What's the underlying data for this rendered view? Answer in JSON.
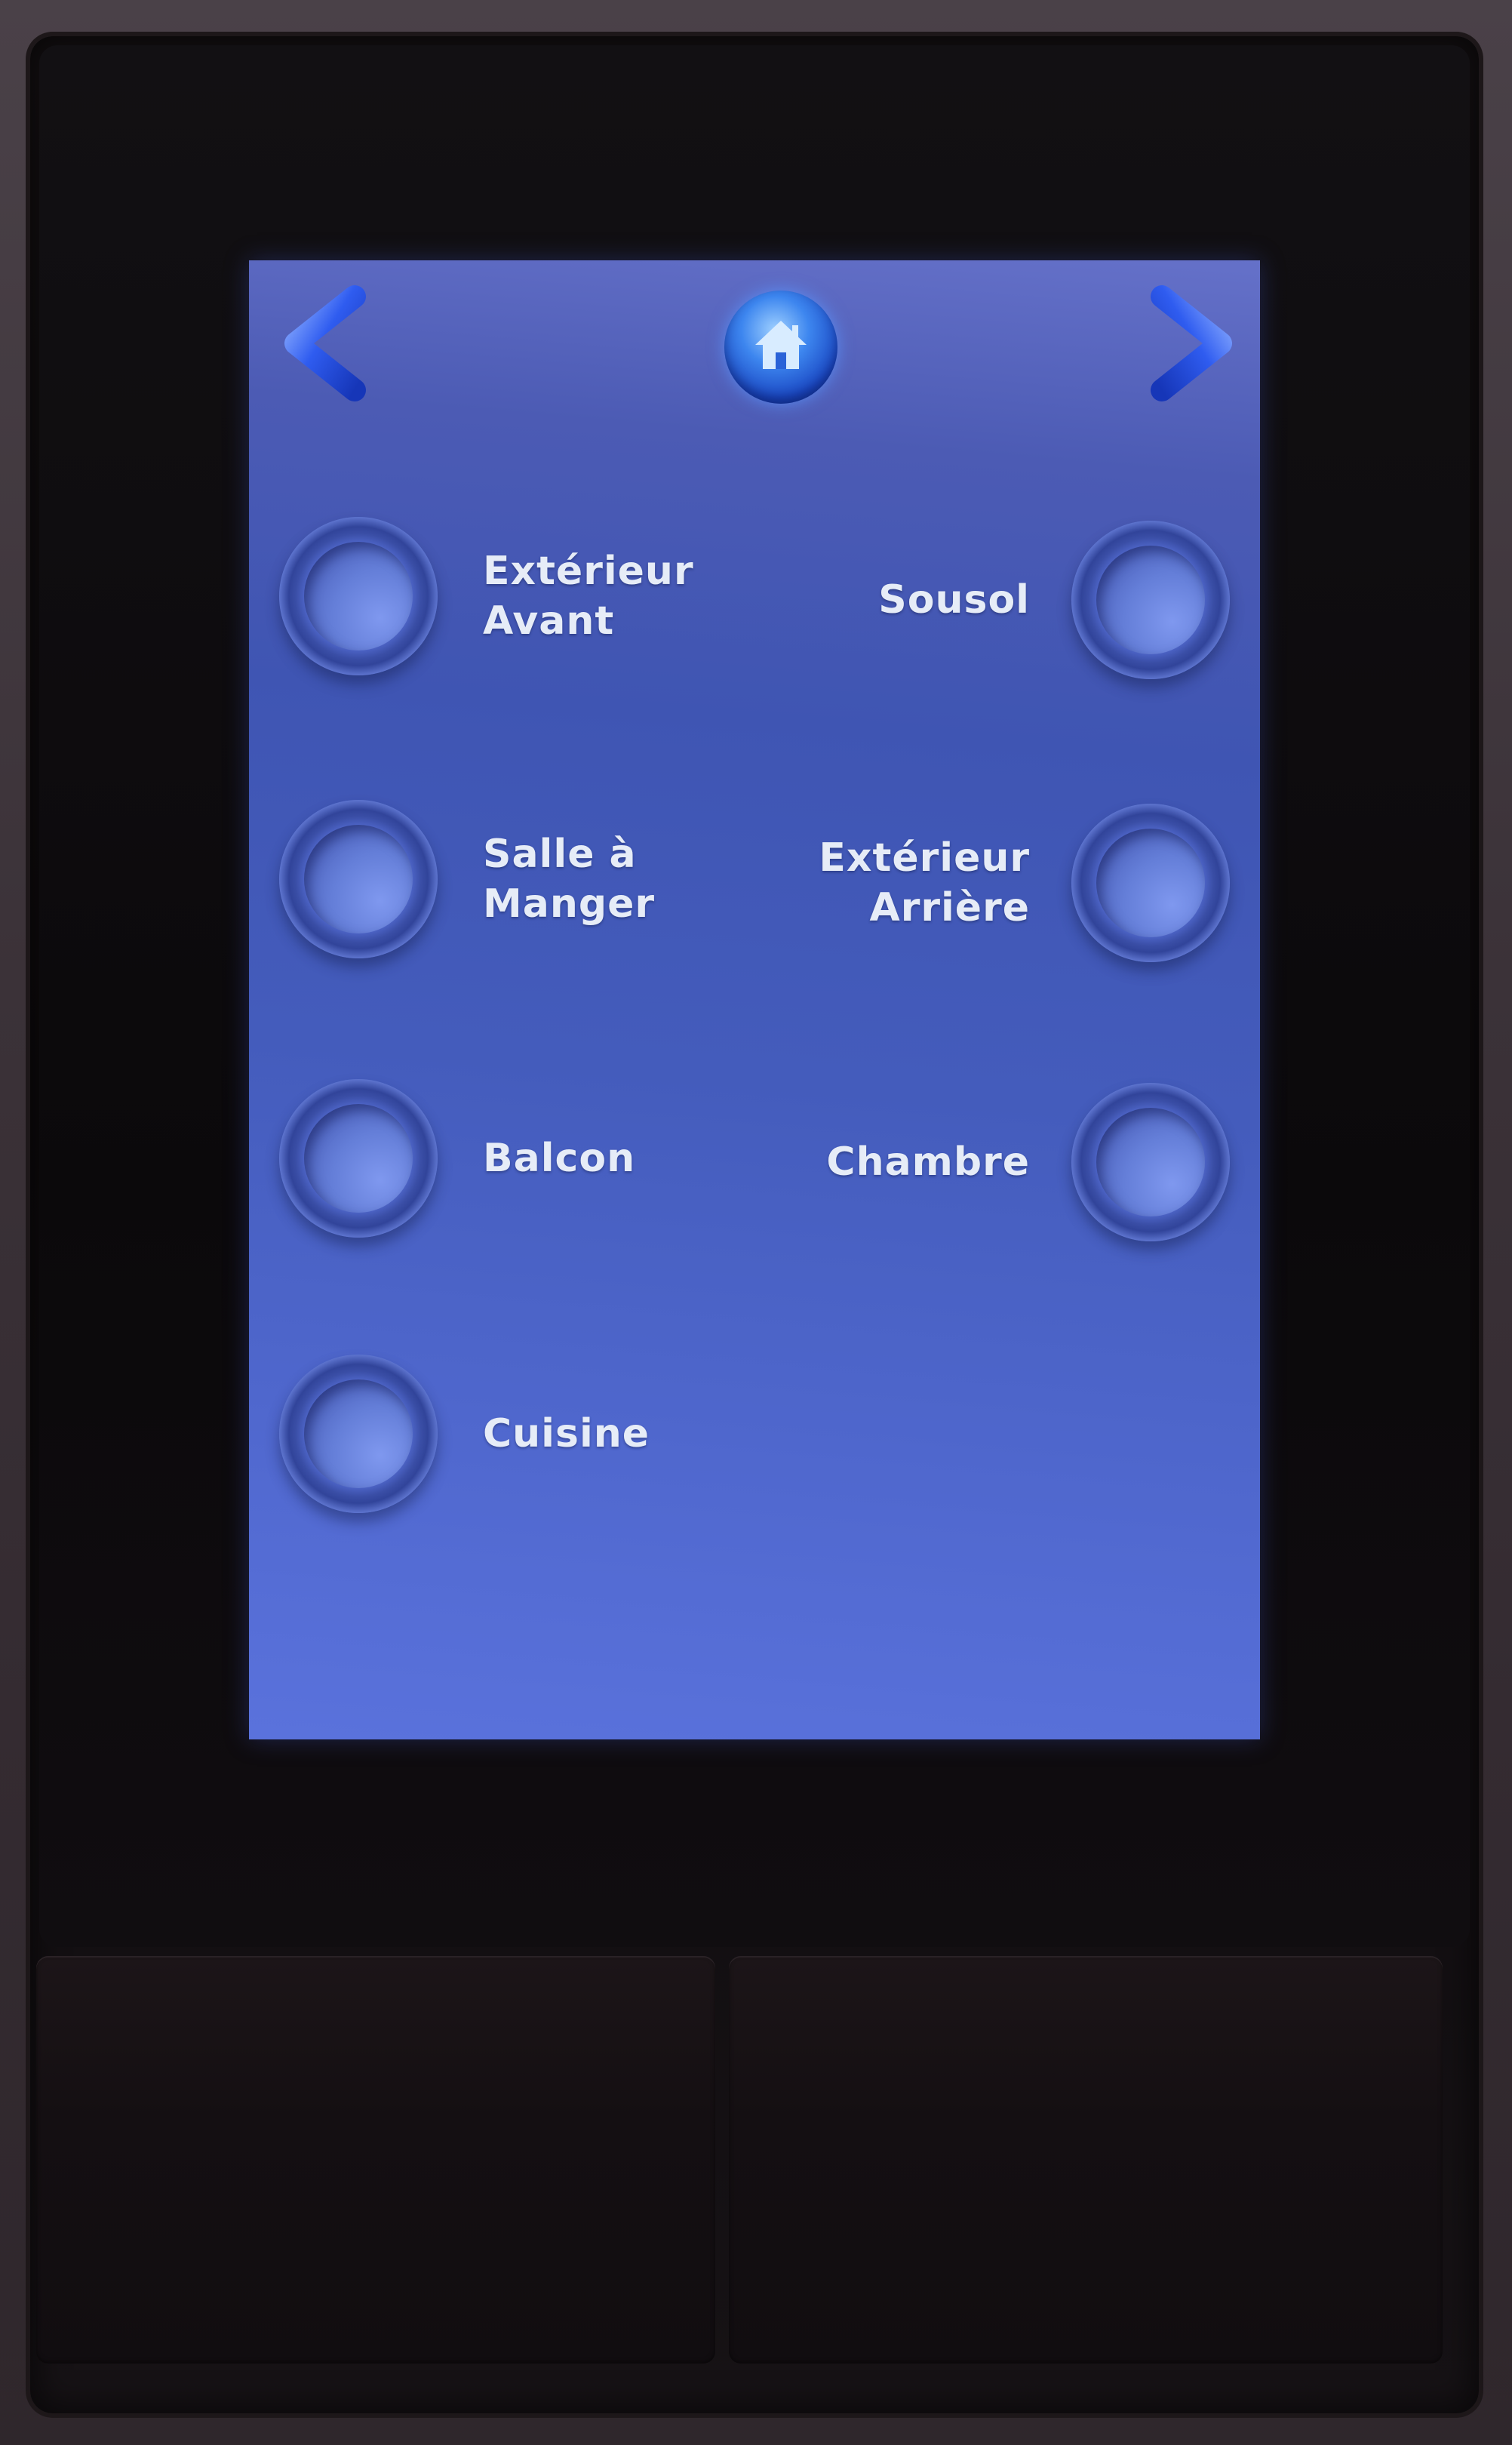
{
  "nav": {
    "prev_icon": "chevron-left-icon",
    "home_icon": "home-icon",
    "next_icon": "chevron-right-icon",
    "accent_color": "#2f5cf0"
  },
  "switches": [
    {
      "label": "Extérieur\nAvant",
      "side": "left"
    },
    {
      "label": "Sousol",
      "side": "right"
    },
    {
      "label": "Salle à\nManger",
      "side": "left"
    },
    {
      "label": "Extérieur\nArrière",
      "side": "right"
    },
    {
      "label": "Balcon",
      "side": "left"
    },
    {
      "label": "Chambre",
      "side": "right"
    },
    {
      "label": "Cuisine",
      "side": "left"
    }
  ],
  "colors": {
    "screen_bg": "#4a60c0",
    "label_text": "#e6ecf7",
    "bezel": "#0f0c0e"
  }
}
